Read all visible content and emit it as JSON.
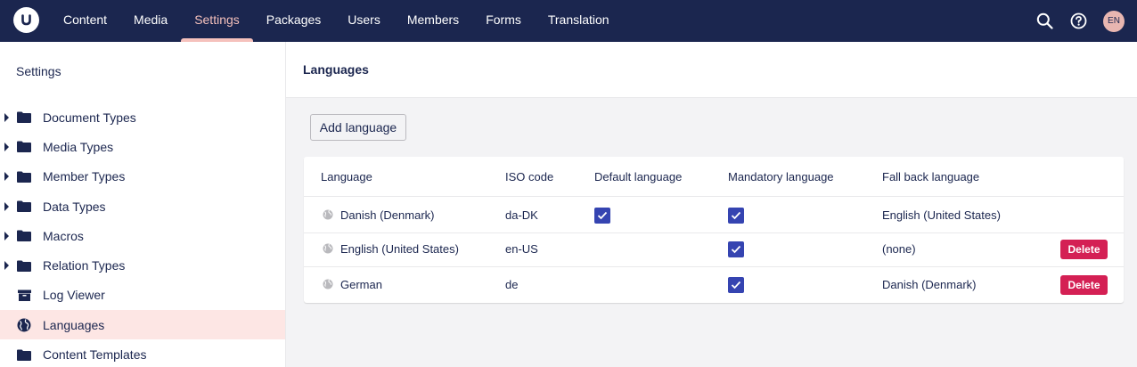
{
  "topnav": {
    "items": [
      {
        "label": "Content",
        "active": false
      },
      {
        "label": "Media",
        "active": false
      },
      {
        "label": "Settings",
        "active": true
      },
      {
        "label": "Packages",
        "active": false
      },
      {
        "label": "Users",
        "active": false
      },
      {
        "label": "Members",
        "active": false
      },
      {
        "label": "Forms",
        "active": false
      },
      {
        "label": "Translation",
        "active": false
      }
    ],
    "avatar_initials": "EN",
    "colors": {
      "bar": "#1b264f",
      "active": "#f5c1bc"
    }
  },
  "sidebar": {
    "title": "Settings",
    "items": [
      {
        "label": "Document Types",
        "icon": "folder-icon",
        "expandable": true
      },
      {
        "label": "Media Types",
        "icon": "folder-icon",
        "expandable": true
      },
      {
        "label": "Member Types",
        "icon": "folder-icon",
        "expandable": true
      },
      {
        "label": "Data Types",
        "icon": "folder-icon",
        "expandable": true
      },
      {
        "label": "Macros",
        "icon": "folder-icon",
        "expandable": true
      },
      {
        "label": "Relation Types",
        "icon": "folder-icon",
        "expandable": true
      },
      {
        "label": "Log Viewer",
        "icon": "archive-icon",
        "expandable": false
      },
      {
        "label": "Languages",
        "icon": "globe-icon",
        "expandable": false,
        "active": true
      },
      {
        "label": "Content Templates",
        "icon": "folder-icon",
        "expandable": false
      }
    ]
  },
  "main": {
    "title": "Languages",
    "add_button": "Add language",
    "table": {
      "headers": {
        "language": "Language",
        "iso": "ISO code",
        "default": "Default language",
        "mandatory": "Mandatory language",
        "fallback": "Fall back language"
      },
      "rows": [
        {
          "language": "Danish (Denmark)",
          "iso": "da-DK",
          "default": true,
          "mandatory": true,
          "fallback": "English (United States)",
          "deletable": false
        },
        {
          "language": "English (United States)",
          "iso": "en-US",
          "default": false,
          "mandatory": true,
          "fallback": "(none)",
          "deletable": true
        },
        {
          "language": "German",
          "iso": "de",
          "default": false,
          "mandatory": true,
          "fallback": "Danish (Denmark)",
          "deletable": true
        }
      ],
      "delete_label": "Delete"
    }
  },
  "colors": {
    "checkbox": "#3544b1",
    "delete": "#d42054",
    "active_row": "#fde6e4"
  }
}
